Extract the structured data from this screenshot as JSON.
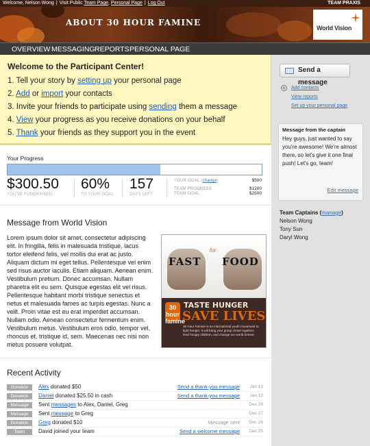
{
  "topbar": {
    "welcome": "Welcome, Nelson Wong",
    "visit": "Visit Public",
    "team_page": "Team Page",
    "personal_page": "Personal Page",
    "logout": "Log Out",
    "team": "TEAM PRAXIS"
  },
  "banner": {
    "title": "ABOUT 30 HOUR FAMINE",
    "logo": "World Vision"
  },
  "nav": {
    "items": [
      "OVERVIEW",
      "MESSAGING",
      "REPORTS",
      "PERSONAL PAGE"
    ]
  },
  "welcome": {
    "title": "Welcome to the Participant Center!",
    "steps": [
      {
        "num": "1.",
        "pre": "Tell your story by ",
        "link": "setting up",
        "post": " your personal page"
      },
      {
        "num": "2.",
        "pre": "",
        "link": "Add",
        "mid": " or ",
        "link2": "import",
        "post": " your contacts"
      },
      {
        "num": "3.",
        "pre": "Invite your friends to participate using ",
        "link": "sending",
        "post": " them a message"
      },
      {
        "num": "4.",
        "pre": "",
        "link": "View",
        "post": " your progress as you receive donations on your behalf"
      },
      {
        "num": "5.",
        "pre": "",
        "link": "Thank",
        "post": " your friends as they support you in the event"
      }
    ]
  },
  "progress": {
    "label": "Your Progress",
    "fraction": 0.6,
    "raised": "$300.50",
    "raised_caption": "YOU'VE FUNDRAISED",
    "percent": "60%",
    "percent_caption": "TO YOUR GOAL",
    "days": "157",
    "days_caption": "DAYS LEFT",
    "your_goal_label": "YOUR GOAL",
    "change": "change",
    "your_goal": "$500",
    "team_progress_label": "TEAM PROGRESS",
    "team_progress": "$1200",
    "team_goal_label": "TEAM GOAL",
    "team_goal": "$2500"
  },
  "message": {
    "title": "Message from World Vision",
    "body": "Lorem ipsum dolor sit amet, consectetur adipiscing elit. In fringilla, felis in malesuada tristique, lacus tortor eleifend felis, vel mollis dui erat ac justo. Aliquam dictum mi eget tellus. Pellentesque vel enim sed risus auctor iaculis. Etiam aliquam. Aenean enim. Vestibulum pretium. Donec accumsan. Nullam pharetra elit eu sem. Quisque egestas elit vel risus. Pellentesque habitant morbi tristique senectus et netus et malesuada fames ac turpis egestas. Nunc a velit. Proin vitae est eu erat imperdiet accumsan. Nullam odio. Aenean consectetur fermentum enim. Vestibulum metus. Vestibulum eros odio, tempor vel, rhoncus et, tristique id, sem. Maecenas nec nisi non metus posuere volutpat."
  },
  "poster": {
    "fist_left": "FAST",
    "fist_right": "FOOD",
    "for": "for",
    "logo": "30 hour famine",
    "headline1": "TASTE HUNGER",
    "headline2": "SAVE LIVES",
    "body": "30 Hour Famine is an international youth movement to fight hunger. It will bring your group closer together, feed hungry children, and change our world forever."
  },
  "sidebar": {
    "send_button": "Send a message",
    "links": [
      "Add contacts",
      "View reports",
      "Set up your personal page"
    ],
    "captain_box": {
      "title": "Message from the captain",
      "message": "Hey guys, just wanted to say you're awesome! We're almost there, so let's give it one final push! Let's go, team!",
      "edit": "Edit message"
    },
    "team_captains_label": "Team Captains",
    "manage": "manage",
    "captains": [
      "Nelson Wong",
      "Tony Sun",
      "Daryl Wong"
    ]
  },
  "activity": {
    "title": "Recent Activity",
    "rows": [
      {
        "type": "Donation",
        "link": "Alex",
        "text": " donated $50",
        "action": "Send a thank-you message",
        "date": "Jan 13"
      },
      {
        "type": "Donation",
        "link": "Daniel",
        "text": " donated $25.50 in cash",
        "action": "Send a thank-you message",
        "date": "Jan 10"
      },
      {
        "type": "Message",
        "pre": "Sent ",
        "link": "messages",
        "text": " to Alex, Daniel, Greg",
        "action": "",
        "date": "Dec 29"
      },
      {
        "type": "Message",
        "pre": "Sent ",
        "link": "message",
        "text": " to Greg",
        "action": "",
        "date": "Dec 27"
      },
      {
        "type": "Donation",
        "link": "Greg",
        "text": " donated $10",
        "action": "Message sent",
        "date": "Dec 26"
      },
      {
        "type": "Team",
        "pre": "David joined your team",
        "link": "",
        "text": "",
        "action": "Send a welcome message",
        "date": "Dec 25"
      }
    ]
  }
}
